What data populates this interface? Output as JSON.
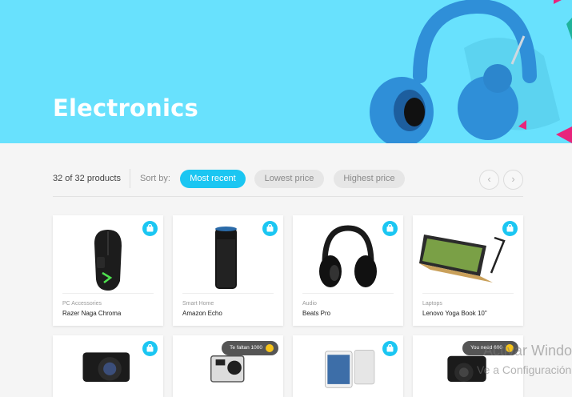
{
  "hero": {
    "title": "Electronics"
  },
  "toolbar": {
    "count": "32 of 32 products",
    "sort_label": "Sort by:",
    "sort_options": [
      "Most recent",
      "Lowest price",
      "Highest price"
    ],
    "active_sort": "Most recent",
    "prev_symbol": "‹",
    "next_symbol": "›"
  },
  "products": [
    {
      "category": "PC Accessories",
      "name": "Razer Naga Chroma",
      "icon": "mouse-icon"
    },
    {
      "category": "Smart Home",
      "name": "Amazon Echo",
      "icon": "speaker-icon"
    },
    {
      "category": "Audio",
      "name": "Beats Pro",
      "icon": "headphones-icon"
    },
    {
      "category": "Laptops",
      "name": "Lenovo Yoga Book 10\"",
      "icon": "laptop-icon"
    },
    {
      "category": "",
      "name": "",
      "icon": "camera-icon"
    },
    {
      "category": "",
      "name": "",
      "icon": "action-camera-icon",
      "badge": "Te faltan 1000"
    },
    {
      "category": "",
      "name": "",
      "icon": "tablet-icon"
    },
    {
      "category": "",
      "name": "",
      "icon": "dslr-camera-icon",
      "badge": "You need 600"
    }
  ],
  "overlay": {
    "line1": "Activar Windows",
    "line2": "Ve a Configuración"
  },
  "colors": {
    "hero": "#68e1fd",
    "accent": "#1bc6f2",
    "coin": "#f4c21a"
  }
}
